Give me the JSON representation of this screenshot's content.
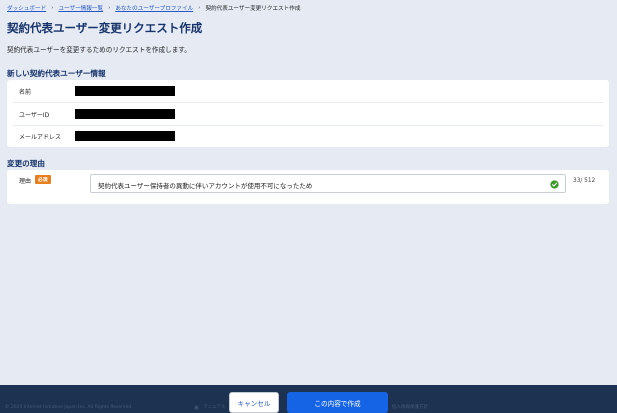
{
  "breadcrumb": {
    "items": [
      "ダッシュボード",
      "ユーザー情報一覧",
      "あなたのユーザープロファイル"
    ],
    "separator": "›",
    "current": "契約代表ユーザー変更リクエスト作成"
  },
  "page": {
    "title": "契約代表ユーザー変更リクエスト作成",
    "description": "契約代表ユーザーを変更するためのリクエストを作成します。"
  },
  "new_user_section": {
    "title": "新しい契約代表ユーザー情報",
    "fields": [
      {
        "label": "名前",
        "value_redacted": true
      },
      {
        "label": "ユーザーID",
        "value_redacted": true
      },
      {
        "label": "メールアドレス",
        "value_redacted": true
      }
    ]
  },
  "reason_section": {
    "title": "変更の理由",
    "label": "理由",
    "required_badge": "必須",
    "value": "契約代表ユーザー保持者の異動に伴いアカウントが使用不可になったため",
    "validation_icon": "check-circle-icon",
    "char_count": "33/ 512"
  },
  "footer": {
    "copyright": "© 2024 Internet Initiative Japan Inc. All Rights Reserved.",
    "faded_text": "マニュアル",
    "right_text": "個人情報保護方針"
  },
  "buttons": {
    "cancel": "キャンセル",
    "submit": "この内容で作成"
  },
  "colors": {
    "page_bg": "#e6eaf2",
    "title": "#16336b",
    "link": "#2458c6",
    "primary": "#1664e6",
    "badge": "#e9801e",
    "footer_bg": "#1d3250",
    "valid": "#3a9a2a"
  }
}
